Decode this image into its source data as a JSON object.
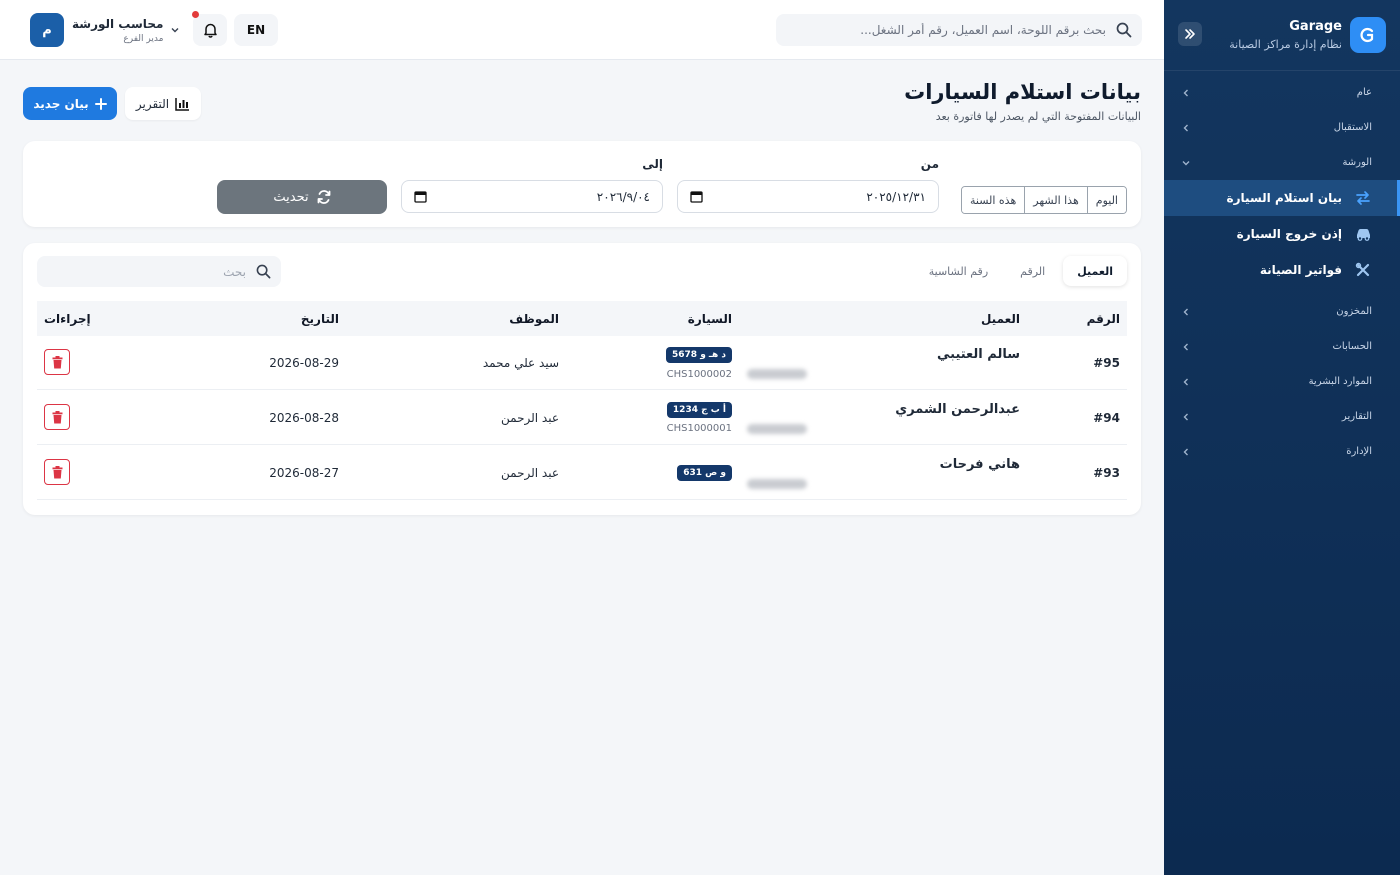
{
  "sidebar": {
    "brand_name": "Garage",
    "brand_sub": "نظام إدارة مراكز الصيانة",
    "logo_letter": "G",
    "groups": [
      {
        "label": "عام"
      },
      {
        "label": "الاستقبال"
      },
      {
        "label": "الورشة"
      }
    ],
    "items": [
      {
        "label": "بيان استلام السيارة",
        "icon": "swap-arrows-icon"
      },
      {
        "label": "إذن خروج السيارة",
        "icon": "car-icon"
      },
      {
        "label": "فواتير الصيانة",
        "icon": "tools-icon"
      }
    ],
    "groups_bottom": [
      {
        "label": "المخزون"
      },
      {
        "label": "الحسابات"
      },
      {
        "label": "الموارد البشرية"
      },
      {
        "label": "التقارير"
      },
      {
        "label": "الإدارة"
      }
    ]
  },
  "topbar": {
    "search_placeholder": "بحث برقم اللوحة، اسم العميل، رقم أمر الشغل...",
    "lang": "EN",
    "user_name": "محاسب الورشة",
    "user_role": "مدير الفرع",
    "avatar_letter": "م"
  },
  "page": {
    "title": "بيانات استلام السيارات",
    "subtitle": "البيانات المفتوحة التي لم يصدر لها فاتورة بعد",
    "new_label": "بيان جديد",
    "report_label": "التقرير"
  },
  "filter": {
    "from_label": "من",
    "to_label": "إلى",
    "presets": [
      "اليوم",
      "هذا الشهر",
      "هذه السنة"
    ],
    "from_value": "٢٠٢٥/١٢/٣١",
    "to_value": "٢٠٢٦/٩/٠٤",
    "refresh_label": "تحديث"
  },
  "table": {
    "tabs": [
      "العميل",
      "الرقم",
      "رقم الشاسية"
    ],
    "search_placeholder": "بحث",
    "headers": {
      "num": "الرقم",
      "client": "العميل",
      "car": "السيارة",
      "employee": "الموظف",
      "date": "التاريخ",
      "actions": "إجراءات"
    },
    "rows": [
      {
        "num": "#95",
        "client": "سالم العتيبي",
        "plate": "د هـ و 5678",
        "chassis": "CHS1000002",
        "employee": "سيد علي محمد",
        "date": "2026-08-29"
      },
      {
        "num": "#94",
        "client": "عبدالرحمن الشمري",
        "plate": "أ ب ج 1234",
        "chassis": "CHS1000001",
        "employee": "عبد الرحمن",
        "date": "2026-08-28"
      },
      {
        "num": "#93",
        "client": "هاني فرحات",
        "plate": "و ص 631",
        "chassis": "",
        "employee": "عبد الرحمن",
        "date": "2026-08-27"
      }
    ]
  },
  "colors": {
    "sidebar_bg": "#13365f",
    "accent": "#1f7ae0",
    "plate_bg": "#14386a",
    "danger": "#dc3545"
  }
}
